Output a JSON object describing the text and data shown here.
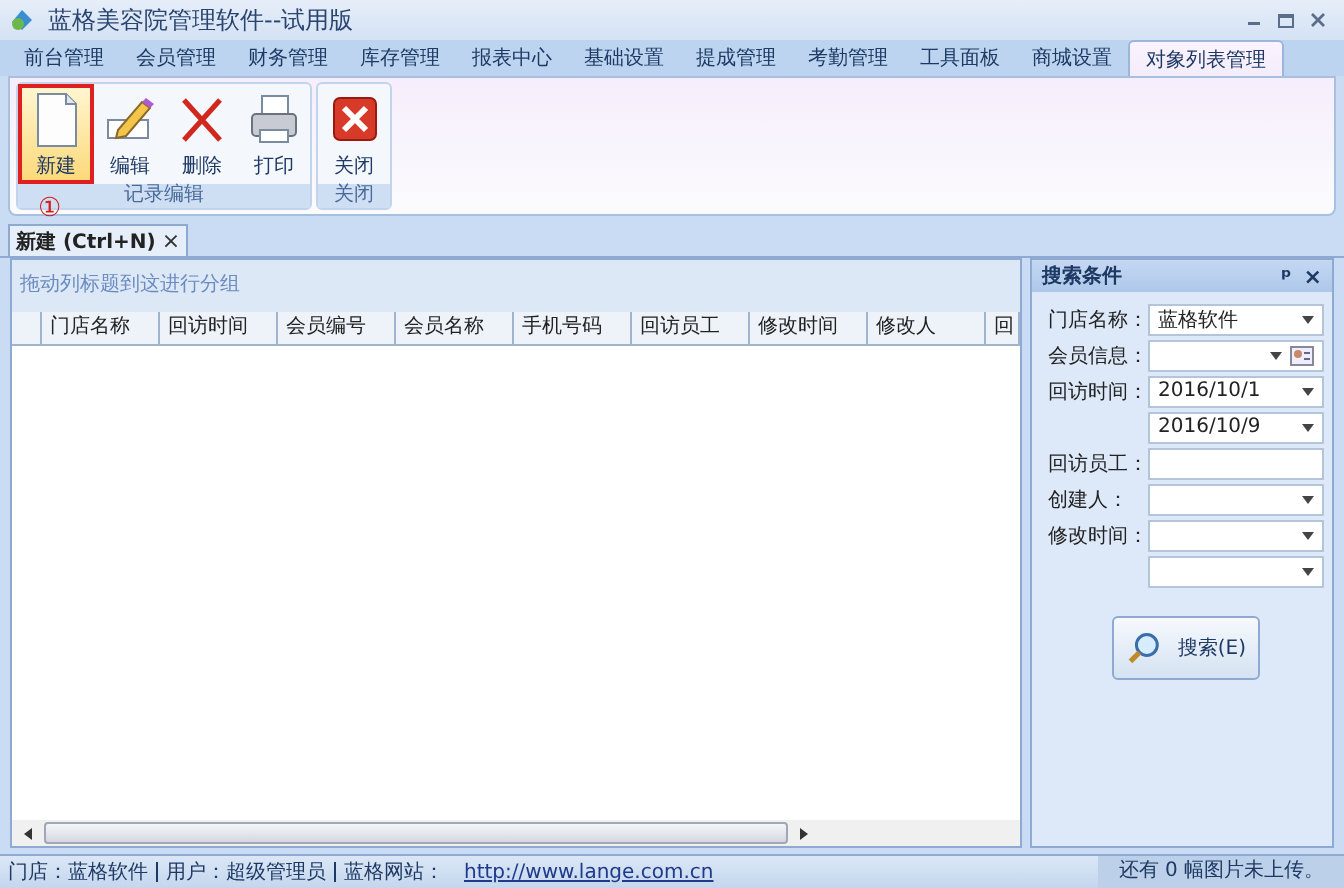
{
  "window": {
    "title": "蓝格美容院管理软件--试用版"
  },
  "menu_tabs": [
    {
      "label": "前台管理",
      "selected": false
    },
    {
      "label": "会员管理",
      "selected": false
    },
    {
      "label": "财务管理",
      "selected": false
    },
    {
      "label": "库存管理",
      "selected": false
    },
    {
      "label": "报表中心",
      "selected": false
    },
    {
      "label": "基础设置",
      "selected": false
    },
    {
      "label": "提成管理",
      "selected": false
    },
    {
      "label": "考勤管理",
      "selected": false
    },
    {
      "label": "工具面板",
      "selected": false
    },
    {
      "label": "商城设置",
      "selected": false
    },
    {
      "label": "对象列表管理",
      "selected": true
    }
  ],
  "ribbon_groups": [
    {
      "label": "记录编辑",
      "buttons": [
        {
          "label": "新建",
          "kind": "new",
          "selected": true
        },
        {
          "label": "编辑",
          "kind": "edit",
          "selected": false
        },
        {
          "label": "删除",
          "kind": "delete",
          "selected": false
        },
        {
          "label": "打印",
          "kind": "print",
          "selected": false
        }
      ]
    },
    {
      "label": "关闭",
      "buttons": [
        {
          "label": "关闭",
          "kind": "close",
          "selected": false
        }
      ]
    }
  ],
  "annotation": "①",
  "document_tab": {
    "label": "新建 (Ctrl+N)",
    "close": "×"
  },
  "grid": {
    "group_hint": "拖动列标题到这进行分组",
    "columns": [
      "门店名称",
      "回访时间",
      "会员编号",
      "会员名称",
      "手机号码",
      "回访员工",
      "修改时间",
      "修改人",
      "回"
    ]
  },
  "search_panel": {
    "title": "搜索条件",
    "pin": "ᵖ",
    "close": "×",
    "fields": [
      {
        "label": "门店名称：",
        "value": "蓝格软件",
        "kind": "dropdown"
      },
      {
        "label": "会员信息：",
        "kind": "picker"
      },
      {
        "label": "回访时间：",
        "value": "2016/10/1",
        "kind": "dropdown"
      },
      {
        "value": "2016/10/9",
        "kind": "dropdown"
      },
      {
        "label": "回访员工：",
        "kind": "text"
      },
      {
        "label": "创建人：",
        "kind": "dropdown"
      },
      {
        "label": "修改时间：",
        "kind": "dropdown"
      },
      {
        "kind": "dropdown"
      }
    ],
    "search_button": "搜索(E)"
  },
  "status_bar": {
    "store": "门店：蓝格软件",
    "user": "用户：超级管理员",
    "site_label": "蓝格网站：",
    "site_link": "http://www.lange.com.cn",
    "upload_note": "还有 0 幅图片未上传。"
  }
}
